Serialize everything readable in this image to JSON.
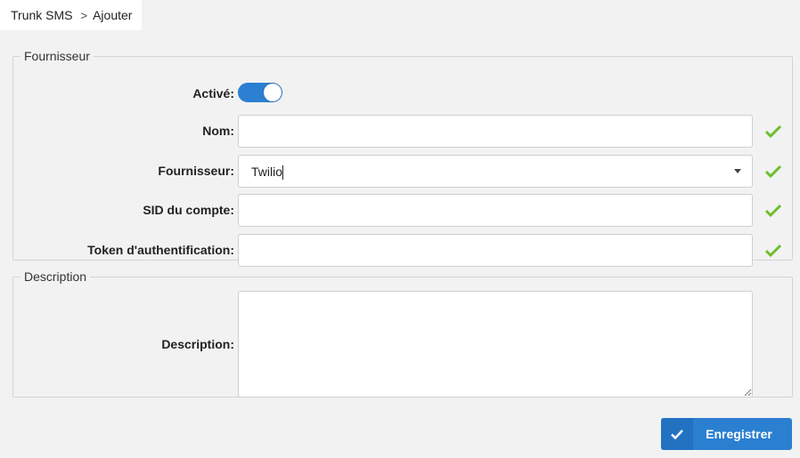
{
  "breadcrumb": {
    "root": "Trunk SMS",
    "separator": ">",
    "current": "Ajouter"
  },
  "fournisseur_group": {
    "legend": "Fournisseur",
    "active_label": "Activé:",
    "active_on": true,
    "nom_label": "Nom:",
    "nom_value": "",
    "fournisseur_label": "Fournisseur:",
    "fournisseur_value": "Twilio",
    "sid_label": "SID du compte:",
    "sid_value": "",
    "token_label": "Token d'authentification:",
    "token_value": ""
  },
  "description_group": {
    "legend": "Description",
    "description_label": "Description:",
    "description_value": ""
  },
  "actions": {
    "save_label": "Enregistrer"
  },
  "colors": {
    "accent": "#2a7fd1",
    "valid": "#6cbf2c"
  }
}
